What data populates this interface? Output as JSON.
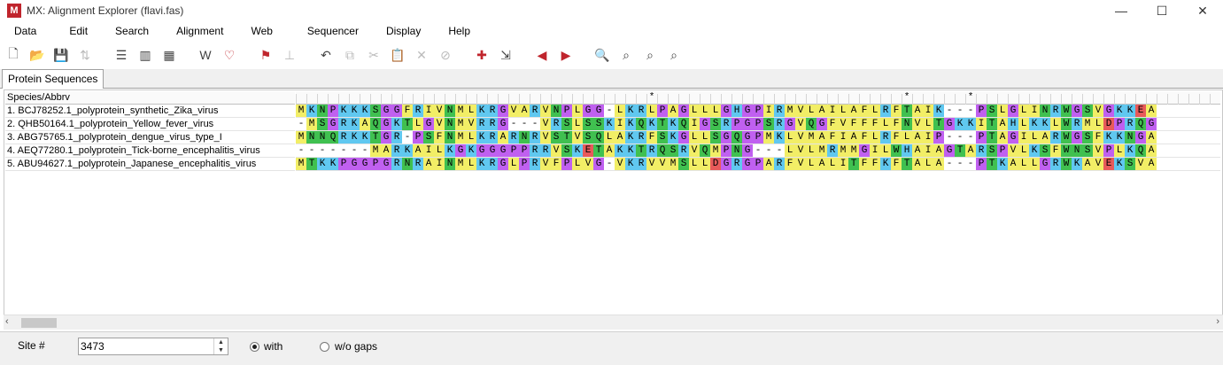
{
  "window": {
    "icon_letter": "M",
    "title": "MX: Alignment Explorer (flavi.fas)",
    "minimize": "—",
    "maximize": "☐",
    "close": "✕"
  },
  "menu": [
    "Data",
    "Edit",
    "Search",
    "Alignment",
    "Web",
    "Sequencer",
    "Display",
    "Help"
  ],
  "toolbar": [
    {
      "name": "new-icon",
      "glyph": "🗋",
      "style": ""
    },
    {
      "name": "open-folder-icon",
      "glyph": "📂",
      "style": ""
    },
    {
      "name": "save-icon",
      "glyph": "💾",
      "style": ""
    },
    {
      "name": "translate-icon",
      "glyph": "⇅",
      "style": "dim"
    },
    {
      "sep": true
    },
    {
      "name": "sequence-data-icon",
      "glyph": "☰",
      "style": ""
    },
    {
      "name": "columns-icon",
      "glyph": "▥",
      "style": ""
    },
    {
      "name": "dna-atcg-icon",
      "glyph": "▦",
      "style": ""
    },
    {
      "sep": true
    },
    {
      "name": "clustalw-icon",
      "glyph": "W",
      "style": ""
    },
    {
      "name": "muscle-icon",
      "glyph": "♡",
      "style": "red"
    },
    {
      "sep": true
    },
    {
      "name": "mark-site-flag-icon",
      "glyph": "⚑",
      "style": "red"
    },
    {
      "name": "insert-gap-icon",
      "glyph": "⊥",
      "style": "dim"
    },
    {
      "sep": true
    },
    {
      "name": "undo-icon",
      "glyph": "↶",
      "style": ""
    },
    {
      "name": "copy-icon",
      "glyph": "⧉",
      "style": "dim"
    },
    {
      "name": "cut-icon",
      "glyph": "✂",
      "style": "dim"
    },
    {
      "name": "paste-icon",
      "glyph": "📋",
      "style": "dim"
    },
    {
      "name": "delete-icon",
      "glyph": "✕",
      "style": "dim"
    },
    {
      "name": "delete-gap-icon",
      "glyph": "⊘",
      "style": "dim"
    },
    {
      "sep": true
    },
    {
      "name": "add-sequence-icon",
      "glyph": "✚",
      "style": "red"
    },
    {
      "name": "import-icon",
      "glyph": "⇲",
      "style": ""
    },
    {
      "sep": true
    },
    {
      "name": "previous-marked-icon",
      "glyph": "◀",
      "style": "red"
    },
    {
      "name": "next-marked-icon",
      "glyph": "▶",
      "style": "red"
    },
    {
      "sep": true
    },
    {
      "name": "find-icon",
      "glyph": "🔍",
      "style": ""
    },
    {
      "name": "find-previous-icon",
      "glyph": "⌕",
      "style": ""
    },
    {
      "name": "find-next-icon",
      "glyph": "⌕",
      "style": ""
    },
    {
      "name": "find-marked-icon",
      "glyph": "⌕",
      "style": ""
    }
  ],
  "tab": "Protein Sequences",
  "alignment": {
    "header": "Species/Abbrv",
    "consensus": "                                 *                       *     *                                  *                   ",
    "sequences": [
      {
        "name": "1. BCJ78252.1_polyprotein_synthetic_Zika_virus",
        "seq": "MKNPKKKSGGFRIVNMLKRGVARVNPLGG-LKRLPAGLLLGHGPIRMVLAILAFLRFTAIK---PSLGLINRWGSVGKKEA"
      },
      {
        "name": "2. QHB50164.1_polyprotein_Yellow_fever_virus",
        "seq": "-MSGRKAQGKTLGVNMVRRG---VRSLSSKIKQKTKQIGSRPGPSRGVQGFVFFFLFNVLTGKKITAHLKKLWRMLDPRQG"
      },
      {
        "name": "3. ABG75765.1_polyprotein_dengue_virus_type_I",
        "seq": "MNNQRKKTGR-PSFNMLKRARNRVSTVSQLAKRFSKGLLSGQGPMKLVMAFIAFLRFLAIP---PTAGILARWGSFKKNGA"
      },
      {
        "name": "4. AEQ77280.1_polyprotein_Tick-borne_encephalitis_virus",
        "seq": "-------MARKAILKGKGGGPPRRVSKETAKKTRQSRVQMPNG---LVLMRMMGILWHAIAGTARSPVLKSFWNSVPLKQA"
      },
      {
        "name": "5. ABU94627.1_polyprotein_Japanese_encephalitis_virus",
        "seq": "MTKKPGGPGRNRAINMLKRGLPRVFPLVG-VKRVVMSLLDGRGPARFVLALITFFKFTALA---PTKALLGRWKAVEKSVA"
      }
    ]
  },
  "status": {
    "site_label": "Site #",
    "site_value": "3473",
    "with_label": "with",
    "without_label": "w/o gaps",
    "with_selected": true
  },
  "residue_colors": {
    "A": "#f2ee66",
    "V": "#f2ee66",
    "L": "#f2ee66",
    "I": "#f2ee66",
    "F": "#f2ee66",
    "M": "#f2ee66",
    "G": "#c060f0",
    "P": "#c060f0",
    "K": "#60c8f0",
    "R": "#60c8f0",
    "H": "#60c8f0",
    "D": "#e85a5a",
    "E": "#e85a5a",
    "N": "#40c050",
    "Q": "#40c050",
    "S": "#40c050",
    "T": "#40c050",
    "W": "#40c050",
    "Y": "#40c050",
    "C": "#40c050",
    "-": "#ffffff"
  }
}
